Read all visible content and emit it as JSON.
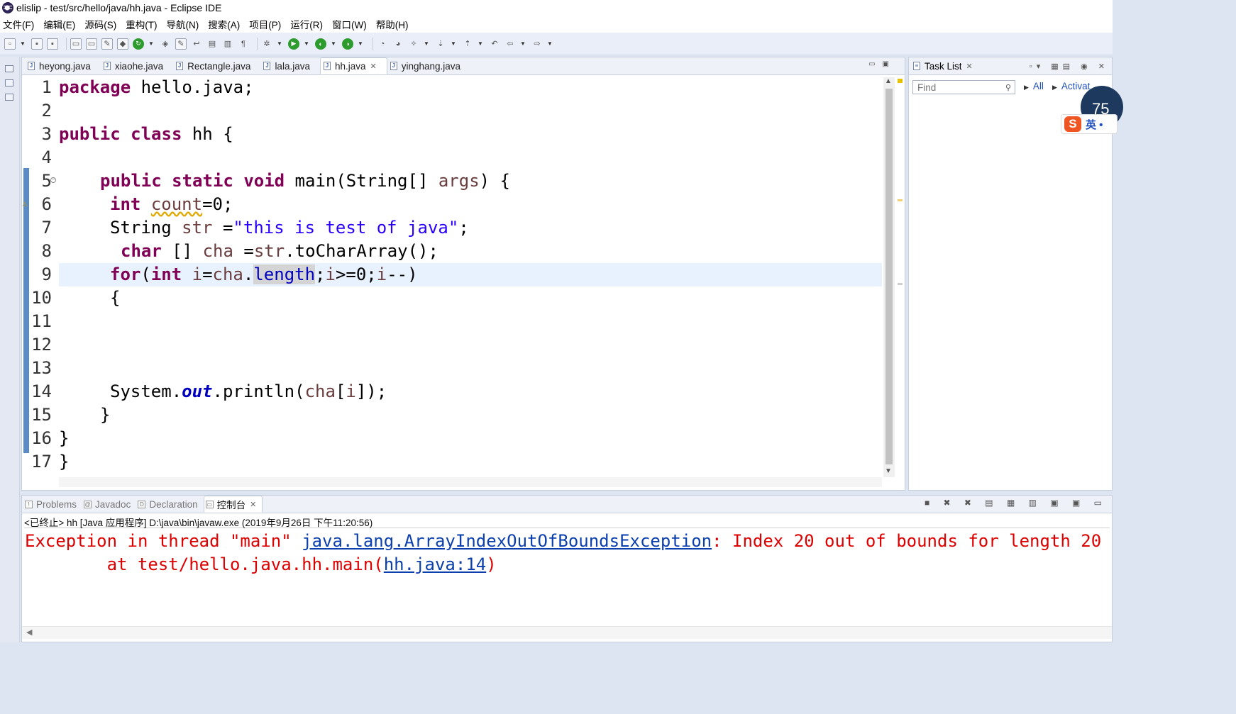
{
  "window": {
    "title": "elislip - test/src/hello/java/hh.java - Eclipse IDE"
  },
  "menu": [
    "文件(F)",
    "编辑(E)",
    "源码(S)",
    "重构(T)",
    "导航(N)",
    "搜索(A)",
    "项目(P)",
    "运行(R)",
    "窗口(W)",
    "帮助(H)"
  ],
  "editor": {
    "tabs": [
      {
        "label": "heyong.java",
        "active": false
      },
      {
        "label": "xiaohe.java",
        "active": false
      },
      {
        "label": "Rectangle.java",
        "active": false
      },
      {
        "label": "lala.java",
        "active": false
      },
      {
        "label": "hh.java",
        "active": true
      },
      {
        "label": "yinghang.java",
        "active": false
      }
    ],
    "line_numbers": [
      "1",
      "2",
      "3",
      "4",
      "5",
      "6",
      "7",
      "8",
      "9",
      "10",
      "11",
      "12",
      "13",
      "14",
      "15",
      "16",
      "17"
    ],
    "current_line": 9,
    "code": {
      "l1_kw": "package",
      "l1_rest": " hello.java;",
      "l3_kw1": "public",
      "l3_kw2": "class",
      "l3_rest": " hh {",
      "l5_kw1": "public",
      "l5_kw2": "static",
      "l5_kw3": "void",
      "l5_a": " main(String[] ",
      "l5_var": "args",
      "l5_b": ") {",
      "l6_kw": "int",
      "l6_var": "count",
      "l6_rest": "=0;",
      "l7_a": "String ",
      "l7_var": "str",
      "l7_b": " =",
      "l7_str": "\"this is test of java\"",
      "l7_c": ";",
      "l8_kw": "char",
      "l8_a": " [] ",
      "l8_var": "cha",
      "l8_b": " =",
      "l8_var2": "str",
      "l8_c": ".toCharArray();",
      "l9_kw1": "for",
      "l9_a": "(",
      "l9_kw2": "int",
      "l9_b": " ",
      "l9_v1": "i",
      "l9_c": "=",
      "l9_v2": "cha",
      "l9_d": ".",
      "l9_sel": "length",
      "l9_e": ";",
      "l9_v3": "i",
      "l9_f": ">=0;",
      "l9_v4": "i",
      "l9_g": "--)",
      "l10": "{",
      "l14_a": "System.",
      "l14_out": "out",
      "l14_b": ".println(",
      "l14_v1": "cha",
      "l14_c": "[",
      "l14_v2": "i",
      "l14_d": "]);",
      "l15": "}",
      "l16": "}",
      "l17": "}"
    }
  },
  "task_list": {
    "tab_label": "Task List",
    "find_placeholder": "Find",
    "filter_all": "All",
    "filter_activate": "Activat",
    "badge_number": "75",
    "ime_label": "英 •"
  },
  "bottom": {
    "tabs": [
      {
        "label": "Problems",
        "active": false
      },
      {
        "label": "Javadoc",
        "active": false
      },
      {
        "label": "Declaration",
        "active": false
      },
      {
        "label": "控制台",
        "active": true
      }
    ],
    "console_status": "<已终止> hh [Java 应用程序] D:\\java\\bin\\javaw.exe  (2019年9月26日 下午11:20:56)",
    "line1_a": "Exception in thread \"main\" ",
    "line1_link": "java.lang.ArrayIndexOutOfBoundsException",
    "line1_b": ": Index 20 out of bounds for length 20",
    "line2_a": "        at test/hello.java.hh.main(",
    "line2_link": "hh.java:14",
    "line2_b": ")"
  }
}
